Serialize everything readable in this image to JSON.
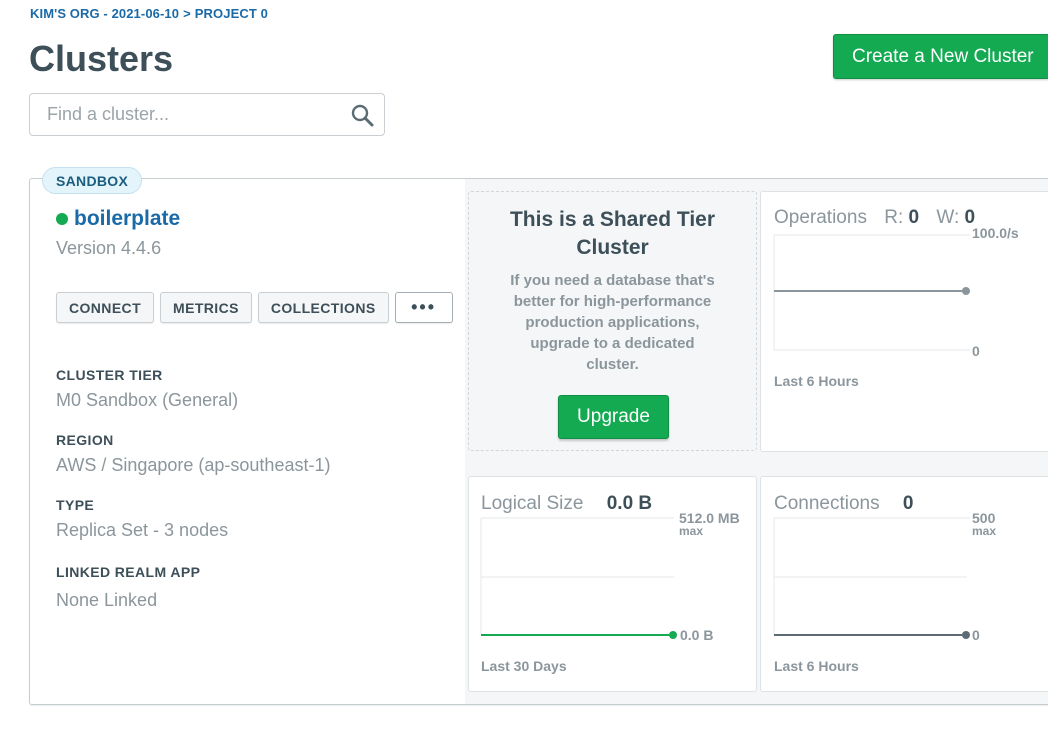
{
  "breadcrumb": {
    "org": "KIM'S ORG - 2021-06-10",
    "separator": ">",
    "project": "PROJECT 0"
  },
  "page": {
    "title": "Clusters",
    "create_label": "Create a New Cluster"
  },
  "search": {
    "placeholder": "Find a cluster..."
  },
  "cluster": {
    "tag": "SANDBOX",
    "name": "boilerplate",
    "status_color": "#13aa52",
    "version": "Version 4.4.6",
    "actions": {
      "connect": "CONNECT",
      "metrics": "METRICS",
      "collections": "COLLECTIONS",
      "more": "•••"
    },
    "details": [
      {
        "label": "CLUSTER TIER",
        "value": "M0 Sandbox (General)"
      },
      {
        "label": "REGION",
        "value": "AWS / Singapore (ap-southeast-1)"
      },
      {
        "label": "TYPE",
        "value": "Replica Set - 3 nodes"
      },
      {
        "label": "LINKED REALM APP",
        "value": "None Linked"
      }
    ]
  },
  "promo": {
    "title": "This is a Shared Tier Cluster",
    "body": "If you need a database that's better for high-performance production applications, upgrade to a dedicated cluster.",
    "upgrade_label": "Upgrade"
  },
  "metrics": {
    "operations": {
      "title": "Operations",
      "r_label": "R:",
      "r_value": "0",
      "w_label": "W:",
      "w_value": "0",
      "max": "100.0/s",
      "min": "0",
      "range": "Last 6 Hours",
      "value": 0,
      "line_color": "#8b969c"
    },
    "logical_size": {
      "title": "Logical Size",
      "value_text": "0.0 B",
      "max": "512.0 MB",
      "max_sub": "max",
      "min": "0.0 B",
      "range": "Last 30 Days",
      "value": 0,
      "line_color": "#13aa52"
    },
    "connections": {
      "title": "Connections",
      "value_text": "0",
      "max": "500",
      "max_sub": "max",
      "min": "0",
      "range": "Last 6 Hours",
      "value": 0,
      "line_color": "#5d6c74"
    }
  },
  "colors": {
    "accent": "#13aa52",
    "link": "#1a6aa8"
  }
}
